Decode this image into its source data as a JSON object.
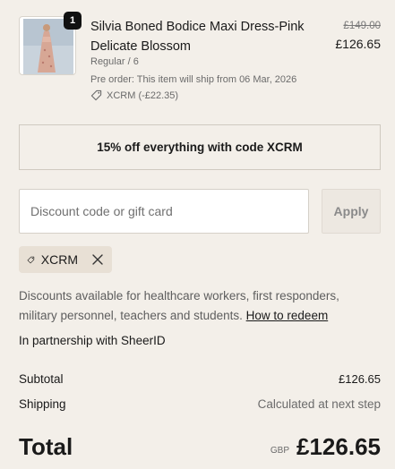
{
  "cart_item": {
    "quantity": "1",
    "name": "Silvia Boned Bodice Maxi Dress-Pink Delicate Blossom",
    "variant": "Regular / 6",
    "preorder_note": "Pre order: This item will ship from 06 Mar, 2026",
    "discount_tag": "XCRM (-£22.35)",
    "original_price": "£149.00",
    "price": "£126.65"
  },
  "promo_banner": "15% off everything with code XCRM",
  "discount": {
    "placeholder": "Discount code or gift card",
    "value": "",
    "apply_label": "Apply",
    "applied_code": "XCRM"
  },
  "discount_info": {
    "text": "Discounts available for healthcare workers, first responders, military personnel, teachers and students.",
    "link": "How to redeem",
    "partnership": "In partnership with SheerID"
  },
  "summary": {
    "subtotal_label": "Subtotal",
    "subtotal_value": "£126.65",
    "shipping_label": "Shipping",
    "shipping_value": "Calculated at next step",
    "total_label": "Total",
    "currency": "GBP",
    "total_value": "£126.65"
  },
  "colors": {
    "background": "#f3efe9",
    "chip_background": "#e8e0d5",
    "text": "#1a1a1a",
    "muted_text": "#6b6b6b"
  }
}
